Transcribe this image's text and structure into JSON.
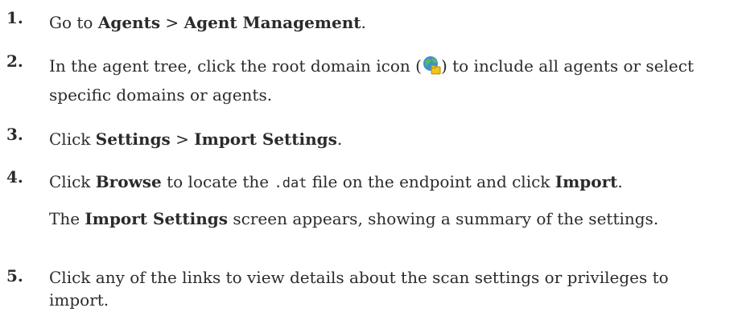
{
  "steps": [
    {
      "number": "1.",
      "parts": [
        "Go to ",
        "Agents",
        " > ",
        "Agent Management",
        "."
      ]
    },
    {
      "number": "2.",
      "before_icon": "In the agent tree, click the root domain icon (",
      "icon": "root-domain-icon",
      "after_icon": ") to include all agents or select specific domains or agents."
    },
    {
      "number": "3.",
      "parts": [
        "Click ",
        "Settings",
        " > ",
        "Import Settings",
        "."
      ]
    },
    {
      "number": "4.",
      "parts": [
        "Click ",
        "Browse",
        " to locate the ",
        ".dat",
        " file on the endpoint and click ",
        "Import",
        "."
      ],
      "note_parts": [
        "The ",
        "Import Settings",
        " screen appears, showing a summary of the settings."
      ]
    },
    {
      "number": "5.",
      "text": "Click any of the links to view details about the scan settings or privileges to import."
    }
  ]
}
